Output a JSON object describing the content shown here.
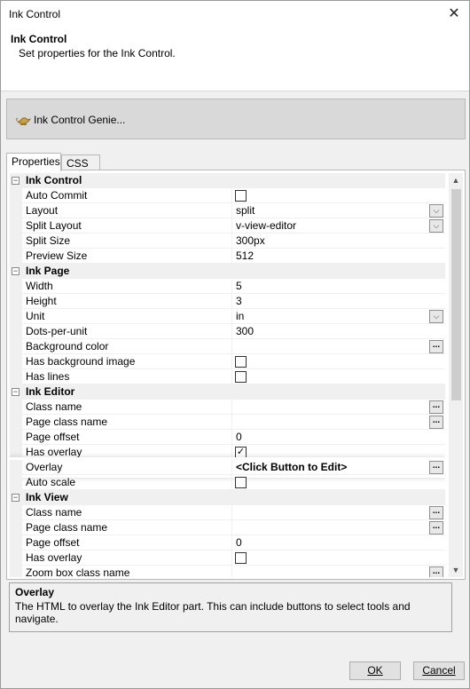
{
  "window": {
    "title": "Ink Control"
  },
  "header": {
    "title": "Ink Control",
    "subtitle": "Set properties for the Ink Control."
  },
  "genie": {
    "label": "Ink Control Genie..."
  },
  "tabs": [
    {
      "label": "Properties",
      "active": true
    },
    {
      "label": "CSS",
      "active": false
    }
  ],
  "grid": {
    "rows": [
      {
        "kind": "category",
        "label": "Ink Control"
      },
      {
        "kind": "prop",
        "name": "Auto Commit",
        "value": "",
        "editor": "checkbox",
        "checked": false
      },
      {
        "kind": "prop",
        "name": "Layout",
        "value": "split",
        "editor": "dropdown"
      },
      {
        "kind": "prop",
        "name": "Split Layout",
        "value": "v-view-editor",
        "editor": "dropdown"
      },
      {
        "kind": "prop",
        "name": "Split Size",
        "value": "300px",
        "editor": "text"
      },
      {
        "kind": "prop",
        "name": "Preview Size",
        "value": "512",
        "editor": "text"
      },
      {
        "kind": "category",
        "label": "Ink Page"
      },
      {
        "kind": "prop",
        "name": "Width",
        "value": "5",
        "editor": "text"
      },
      {
        "kind": "prop",
        "name": "Height",
        "value": "3",
        "editor": "text"
      },
      {
        "kind": "prop",
        "name": "Unit",
        "value": "in",
        "editor": "dropdown"
      },
      {
        "kind": "prop",
        "name": "Dots-per-unit",
        "value": "300",
        "editor": "text"
      },
      {
        "kind": "prop",
        "name": "Background color",
        "value": "",
        "editor": "ellipsis"
      },
      {
        "kind": "prop",
        "name": "Has background image",
        "value": "",
        "editor": "checkbox",
        "checked": false
      },
      {
        "kind": "prop",
        "name": "Has lines",
        "value": "",
        "editor": "checkbox",
        "checked": false
      },
      {
        "kind": "category",
        "label": "Ink Editor"
      },
      {
        "kind": "prop",
        "name": "Class name",
        "value": "",
        "editor": "ellipsis"
      },
      {
        "kind": "prop",
        "name": "Page class name",
        "value": "",
        "editor": "ellipsis"
      },
      {
        "kind": "prop",
        "name": "Page offset",
        "value": "0",
        "editor": "text"
      },
      {
        "kind": "prop",
        "name": "Has overlay",
        "value": "",
        "editor": "checkbox",
        "checked": true
      },
      {
        "kind": "prop",
        "name": "Overlay",
        "value": "<Click Button to Edit>",
        "editor": "ellipsis",
        "selected": true
      },
      {
        "kind": "prop",
        "name": "Auto scale",
        "value": "",
        "editor": "checkbox",
        "checked": false
      },
      {
        "kind": "category",
        "label": "Ink View"
      },
      {
        "kind": "prop",
        "name": "Class name",
        "value": "",
        "editor": "ellipsis"
      },
      {
        "kind": "prop",
        "name": "Page class name",
        "value": "",
        "editor": "ellipsis"
      },
      {
        "kind": "prop",
        "name": "Page offset",
        "value": "0",
        "editor": "text"
      },
      {
        "kind": "prop",
        "name": "Has overlay",
        "value": "",
        "editor": "checkbox",
        "checked": false
      },
      {
        "kind": "prop",
        "name": "Zoom box class name",
        "value": "",
        "editor": "ellipsis"
      }
    ]
  },
  "description": {
    "title": "Overlay",
    "text": "The HTML to overlay the Ink Editor part. This can include buttons to select tools and navigate."
  },
  "buttons": {
    "ok": "OK",
    "cancel": "Cancel"
  },
  "icons": {
    "expand": "minus-box-icon",
    "dropdown": "chevron-down-icon",
    "ellipsis": "ellipsis-icon",
    "genie": "lamp-icon"
  }
}
